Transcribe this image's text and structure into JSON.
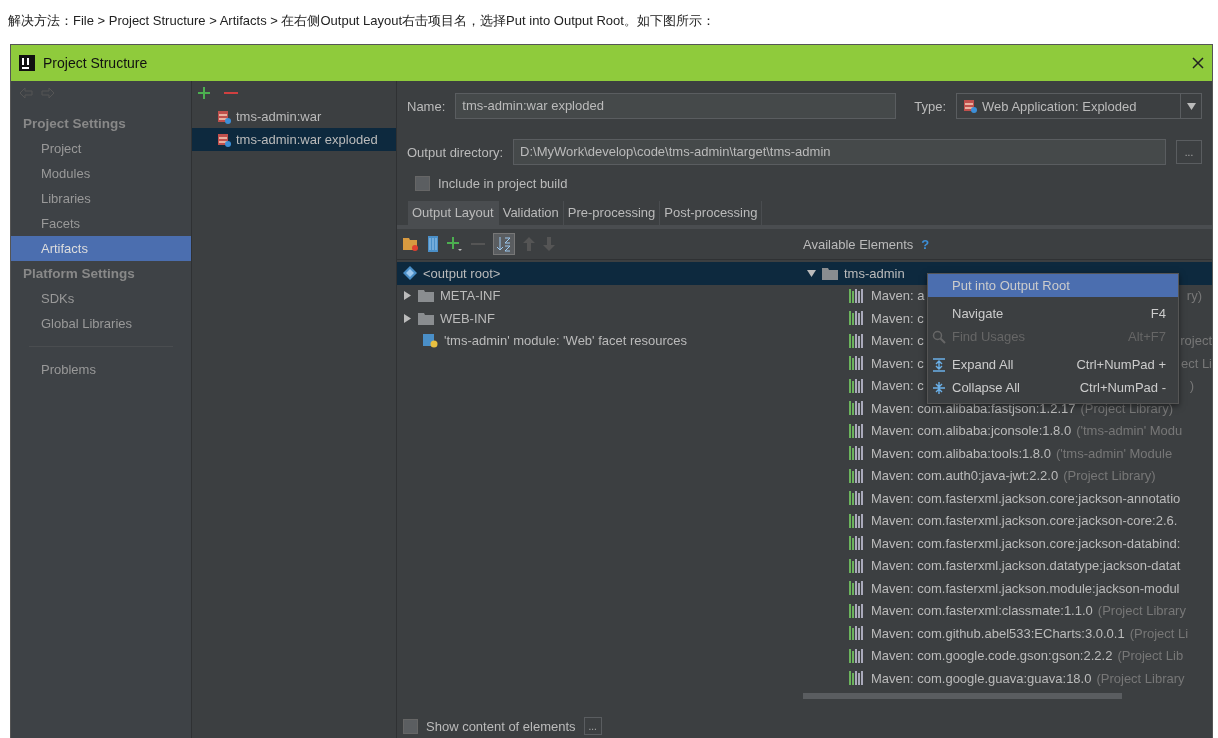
{
  "instruction": "解决方法：File > Project Structure > Artifacts > 在右侧Output Layout右击项目名，选择Put into Output Root。如下图所示：",
  "window": {
    "title": "Project Structure"
  },
  "sidebar": {
    "sections": [
      {
        "heading": "Project Settings",
        "items": [
          {
            "label": "Project",
            "selected": false
          },
          {
            "label": "Modules",
            "selected": false
          },
          {
            "label": "Libraries",
            "selected": false
          },
          {
            "label": "Facets",
            "selected": false
          },
          {
            "label": "Artifacts",
            "selected": true
          }
        ]
      },
      {
        "heading": "Platform Settings",
        "items": [
          {
            "label": "SDKs",
            "selected": false
          },
          {
            "label": "Global Libraries",
            "selected": false
          }
        ]
      }
    ],
    "footer_items": [
      {
        "label": "Problems",
        "selected": false
      }
    ]
  },
  "artifacts": [
    {
      "label": "tms-admin:war",
      "selected": false
    },
    {
      "label": "tms-admin:war exploded",
      "selected": true
    }
  ],
  "form": {
    "name_label": "Name:",
    "name_value": "tms-admin:war exploded",
    "type_label": "Type:",
    "type_value": "Web Application: Exploded",
    "output_label": "Output directory:",
    "output_value": "D:\\MyWork\\develop\\code\\tms-admin\\target\\tms-admin",
    "browse": "...",
    "include": {
      "label": "Include in project build",
      "checked": false
    }
  },
  "tabs": [
    {
      "label": "Output Layout",
      "selected": true
    },
    {
      "label": "Validation",
      "selected": false
    },
    {
      "label": "Pre-processing",
      "selected": false
    },
    {
      "label": "Post-processing",
      "selected": false
    }
  ],
  "output_tree": [
    {
      "kind": "root",
      "label": "<output root>",
      "selected": true
    },
    {
      "kind": "folder",
      "label": "META-INF",
      "selected": false
    },
    {
      "kind": "folder",
      "label": "WEB-INF",
      "selected": false
    },
    {
      "kind": "facet",
      "label": "'tms-admin' module: 'Web' facet resources",
      "selected": false
    }
  ],
  "available": {
    "heading": "Available Elements",
    "help": "?",
    "root": {
      "label": "tms-admin",
      "expanded": true,
      "selected": true
    },
    "items": [
      {
        "label": "Maven: a",
        "note": "ry)"
      },
      {
        "label": "Maven: c"
      },
      {
        "label": "Maven: c",
        "note": "roject"
      },
      {
        "label": "Maven: c",
        "note": "ect Li"
      },
      {
        "label": "Maven: c",
        "note": ")"
      },
      {
        "label": "Maven: com.alibaba:fastjson:1.2.17",
        "note": "(Project Library)"
      },
      {
        "label": "Maven: com.alibaba:jconsole:1.8.0",
        "note": "('tms-admin' Modu"
      },
      {
        "label": "Maven: com.alibaba:tools:1.8.0",
        "note": "('tms-admin' Module"
      },
      {
        "label": "Maven: com.auth0:java-jwt:2.2.0",
        "note": "(Project Library)"
      },
      {
        "label": "Maven: com.fasterxml.jackson.core:jackson-annotatio"
      },
      {
        "label": "Maven: com.fasterxml.jackson.core:jackson-core:2.6."
      },
      {
        "label": "Maven: com.fasterxml.jackson.core:jackson-databind:"
      },
      {
        "label": "Maven: com.fasterxml.jackson.datatype:jackson-datat"
      },
      {
        "label": "Maven: com.fasterxml.jackson.module:jackson-modul"
      },
      {
        "label": "Maven: com.fasterxml:classmate:1.1.0",
        "note": "(Project Library"
      },
      {
        "label": "Maven: com.github.abel533:ECharts:3.0.0.1",
        "note": "(Project Li"
      },
      {
        "label": "Maven: com.google.code.gson:gson:2.2.2",
        "note": "(Project Lib"
      },
      {
        "label": "Maven: com.google.guava:guava:18.0",
        "note": "(Project Library"
      }
    ]
  },
  "context_menu": [
    {
      "kind": "item",
      "label": "Put into Output Root",
      "selected": true,
      "disabled": false
    },
    {
      "kind": "item",
      "label": "Navigate",
      "shortcut": "F4",
      "selected": false,
      "disabled": false
    },
    {
      "kind": "search",
      "label": "Find Usages",
      "shortcut": "Alt+F7",
      "selected": false,
      "disabled": true
    },
    {
      "kind": "expand",
      "label": "Expand All",
      "shortcut": "Ctrl+NumPad +",
      "selected": false,
      "disabled": false
    },
    {
      "kind": "collapse",
      "label": "Collapse All",
      "shortcut": "Ctrl+NumPad -",
      "selected": false,
      "disabled": false
    }
  ],
  "show_content": {
    "label": "Show content of elements",
    "checked": false,
    "button": "..."
  }
}
